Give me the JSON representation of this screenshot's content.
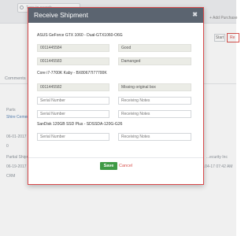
{
  "background": {
    "search_placeholder": "Type to search",
    "add_purchase_label": "+ Add Purchase",
    "start_button": "Start",
    "receive_button": "Re",
    "comments_tab": "Comments",
    "parts_label": "Parts",
    "part_link": "Shire Cement",
    "date_1": "06-01-2017",
    "qty": "0",
    "partial_shipment": "Partial Shipment",
    "date_2": "06-19-2017",
    "vendor_fragment": "...ecurity Inc",
    "datetime_fragment": "...04-17 07:42 AM",
    "crm": "CRM"
  },
  "modal": {
    "title": "Receive Shipment",
    "close_icon": "close-icon",
    "items": [
      {
        "name": "ASUS GeForce GTX 1060 - Dual-GTX1060-O6G",
        "rows": [
          {
            "serial": "0011445584",
            "notes": "Good"
          },
          {
            "serial": "0011445583",
            "notes": "Damanged"
          }
        ]
      },
      {
        "name": "Core i7-7700K Kaby - BX80677I77700K",
        "rows": [
          {
            "serial": "0011445582",
            "notes": "Missing original box"
          },
          {
            "serial": "",
            "notes": ""
          }
        ]
      },
      {
        "name": "SanDisk 120GB SSD Plus - SDSSDA-120G-G26",
        "rows": [
          {
            "serial": "",
            "notes": ""
          }
        ]
      }
    ],
    "serial_placeholder": "Serial Number",
    "notes_placeholder": "Receiving Notes",
    "save_label": "Save",
    "cancel_label": "Cancel"
  }
}
